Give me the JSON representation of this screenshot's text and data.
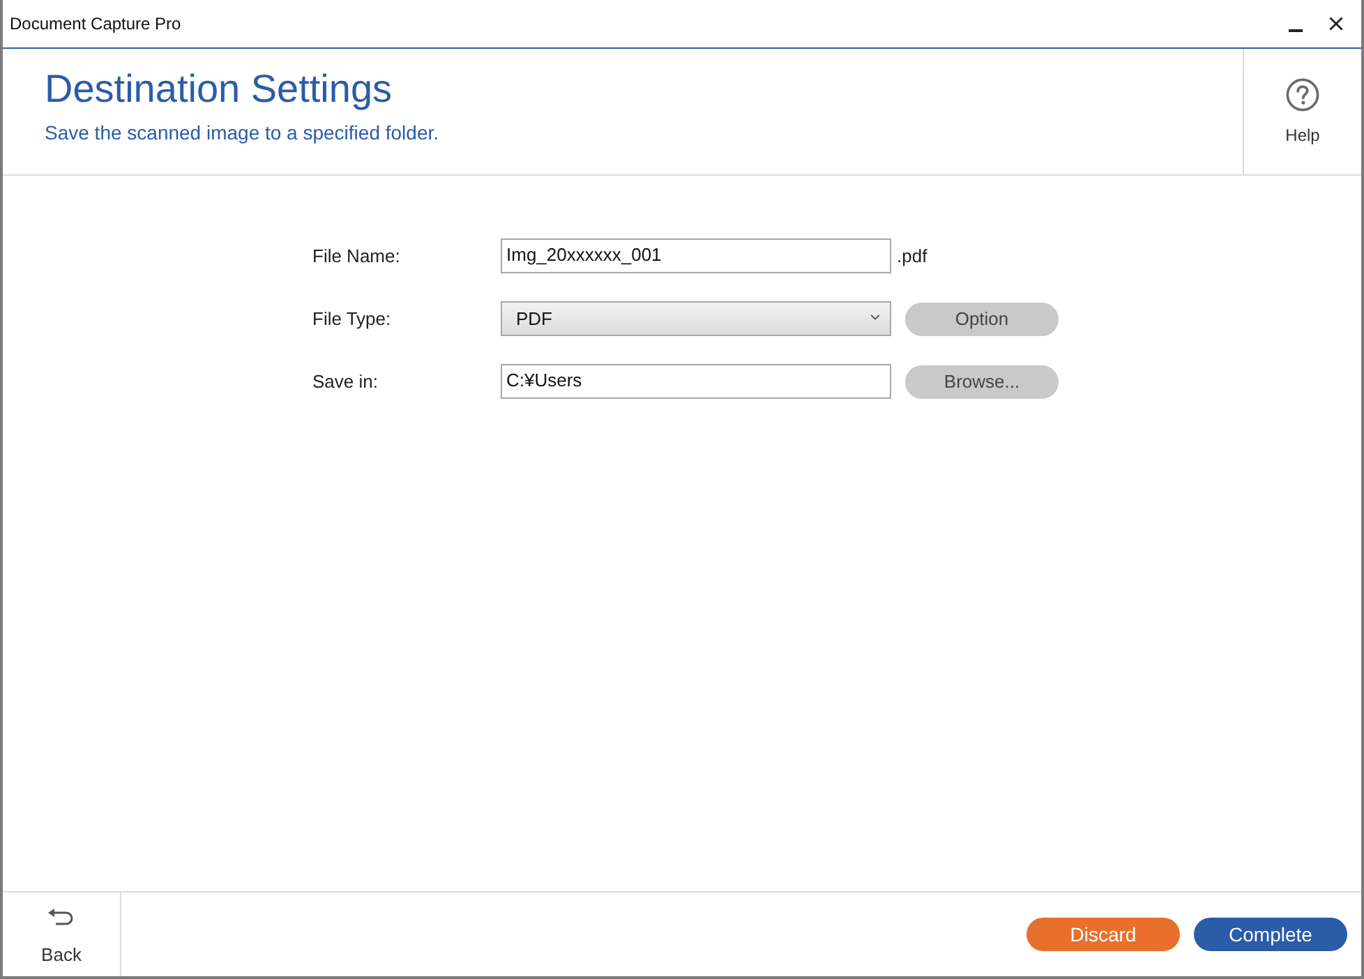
{
  "window": {
    "title": "Document Capture Pro"
  },
  "header": {
    "title": "Destination Settings",
    "subtitle": "Save the scanned image to a specified folder.",
    "help": {
      "label": "Help"
    }
  },
  "form": {
    "rows": [
      {
        "kind": "text",
        "label": "File Name:",
        "value": "Img_20xxxxxx_001",
        "suffix": ".pdf"
      },
      {
        "kind": "select",
        "label": "File Type:",
        "value": "PDF",
        "button": "Option"
      },
      {
        "kind": "text",
        "label": "Save in:",
        "value": "C:¥Users",
        "button": "Browse..."
      }
    ]
  },
  "footer": {
    "back": {
      "label": "Back"
    },
    "buttons": [
      {
        "kind": "discard",
        "label": "Discard"
      },
      {
        "kind": "complete",
        "label": "Complete"
      }
    ]
  }
}
